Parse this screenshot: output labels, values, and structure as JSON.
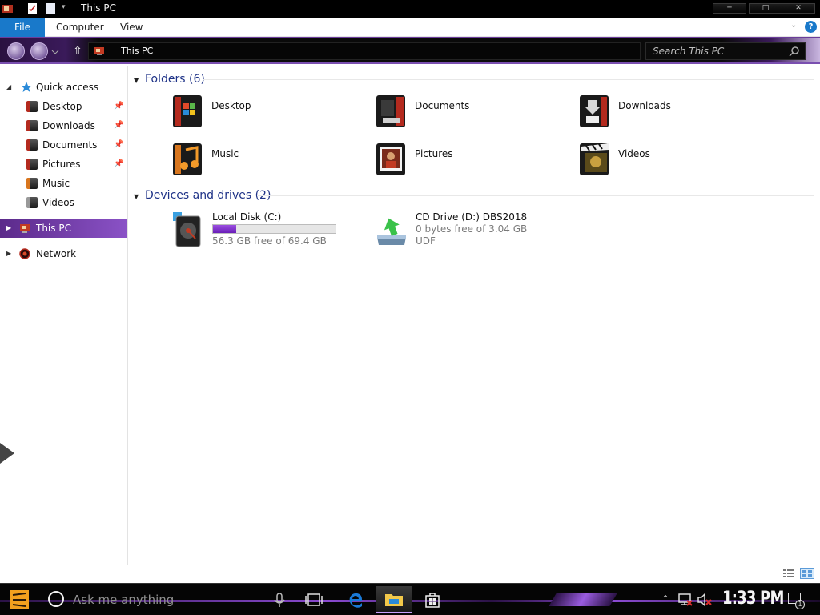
{
  "window": {
    "title": "This PC",
    "controls": {
      "minimize": "─",
      "maximize": "□",
      "close": "✕"
    }
  },
  "ribbon": {
    "tabs": [
      "File",
      "Computer",
      "View"
    ],
    "expand_glyph": "⌄",
    "help_glyph": "?"
  },
  "address_bar": {
    "path": "This PC",
    "search_placeholder": "Search This PC"
  },
  "nav_pane": {
    "quick_access": {
      "label": "Quick access",
      "items": [
        {
          "label": "Desktop",
          "pinned": true
        },
        {
          "label": "Downloads",
          "pinned": true
        },
        {
          "label": "Documents",
          "pinned": true
        },
        {
          "label": "Pictures",
          "pinned": true
        },
        {
          "label": "Music",
          "pinned": false
        },
        {
          "label": "Videos",
          "pinned": false
        }
      ]
    },
    "this_pc": "This PC",
    "network": "Network"
  },
  "content": {
    "folders_header": "Folders (6)",
    "folders": [
      "Desktop",
      "Documents",
      "Downloads",
      "Music",
      "Pictures",
      "Videos"
    ],
    "devices_header": "Devices and drives (2)",
    "drives": [
      {
        "name": "Local Disk (C:)",
        "free_text": "56.3 GB free of 69.4 GB",
        "used_fraction": 0.19
      },
      {
        "name": "CD Drive (D:) DBS2018",
        "free_text": "0 bytes free of 3.04 GB",
        "fs": "UDF"
      }
    ]
  },
  "taskbar": {
    "search_placeholder": "Ask me anything",
    "clock": "1:33 PM",
    "notification_count": "1"
  },
  "colors": {
    "file_tab": "#1979ca",
    "accent_purple": "#8a52c6",
    "group_header_text": "#1e3287",
    "capacity_fill": "#6a1fb8"
  }
}
